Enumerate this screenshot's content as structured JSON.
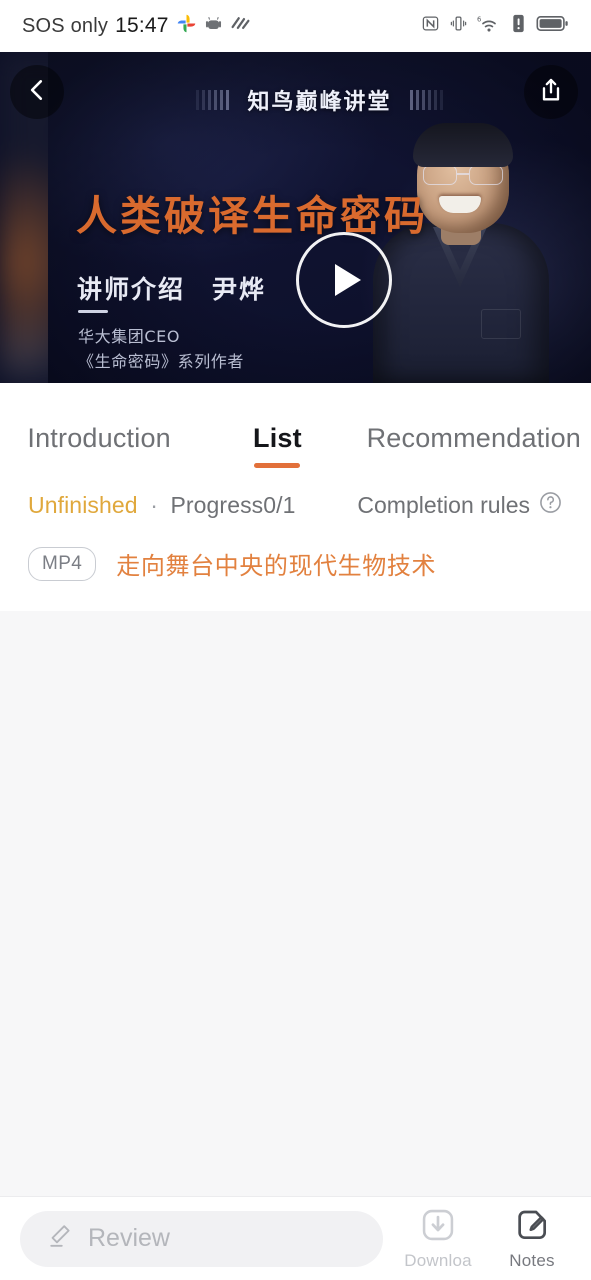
{
  "statusbar": {
    "carrier": "SOS only",
    "time": "15:47",
    "icons_left": [
      "google-photos-icon",
      "android-robot-icon",
      "wave-icon"
    ],
    "icons_right": [
      "nfc-icon",
      "vibrate-icon",
      "wifi-6-icon",
      "alert-icon",
      "battery-icon"
    ]
  },
  "banner": {
    "back_icon": "chevron-left-icon",
    "share_icon": "share-upload-icon",
    "brand": "知鸟巅峰讲堂",
    "title": "人类破译生命密码",
    "speaker_intro": "讲师介绍　尹烨",
    "speaker_role": "华大集团CEO",
    "speaker_work": "《生命密码》系列作者",
    "play_icon": "play-triangle-icon",
    "accent_color": "#d96a2e",
    "background_color": "#101331"
  },
  "tabs": [
    {
      "label": "Introduction",
      "active": false
    },
    {
      "label": "List",
      "active": true
    },
    {
      "label": "Recommendation",
      "active": false
    }
  ],
  "progress": {
    "status": "Unfinished",
    "separator": "·",
    "text": "Progress0/1",
    "rules_label": "Completion rules",
    "rules_icon": "question-circle-icon",
    "status_color": "#e0a83c"
  },
  "lessons": [
    {
      "badge": "MP4",
      "title": "走向舞台中央的现代生物技术",
      "title_color": "#e2813f"
    }
  ],
  "bottombar": {
    "review_placeholder": "Review",
    "review_value": "",
    "review_icon": "pencil-icon",
    "download_label": "Downloa",
    "download_icon": "download-icon",
    "download_disabled": true,
    "notes_label": "Notes",
    "notes_icon": "note-pencil-icon"
  }
}
